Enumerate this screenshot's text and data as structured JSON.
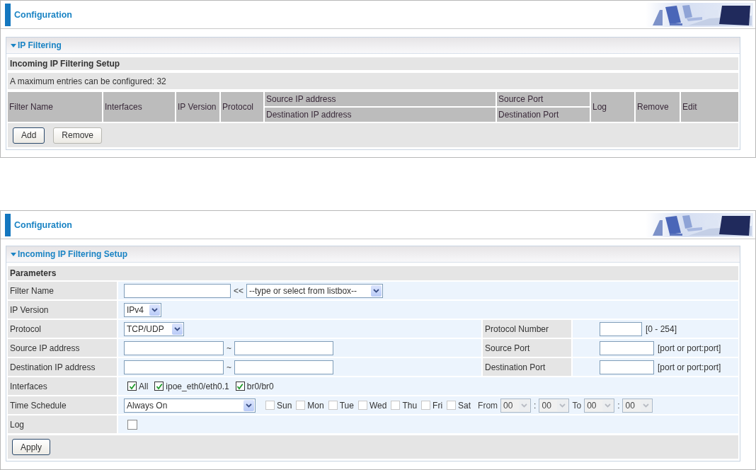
{
  "list_page": {
    "header": {
      "title": "Configuration"
    },
    "section": {
      "title": "IP Filtering",
      "expanded": true
    },
    "subtitle": "Incoming IP Filtering Setup",
    "note": "A maximum entries can be configured: 32",
    "table": {
      "columns": [
        {
          "label": "Filter Name"
        },
        {
          "label": "Interfaces"
        },
        {
          "label": "IP Version"
        },
        {
          "label": "Protocol"
        },
        {
          "top": "Source IP address",
          "bottom": "Destination IP address"
        },
        {
          "top": "Source Port",
          "bottom": "Destination Port"
        },
        {
          "label": "Log"
        },
        {
          "label": "Remove"
        },
        {
          "label": "Edit"
        }
      ]
    },
    "buttons": [
      {
        "label": "Add",
        "focused": true
      },
      {
        "label": "Remove",
        "focused": false
      }
    ]
  },
  "edit_page": {
    "header": {
      "title": "Configuration"
    },
    "section": {
      "title": "Incoming IP Filtering Setup",
      "expanded": true
    },
    "subtitle": "Parameters",
    "rows": [
      {
        "kind": "text_select",
        "label": "Filter Name",
        "separator": "<<",
        "select": "--type or select from listbox--"
      },
      {
        "kind": "select",
        "label": "IP Version",
        "select": "IPv4"
      },
      {
        "kind": "select",
        "label": "Protocol",
        "select": "TCP/UDP",
        "side": {
          "label": "Protocol Number",
          "hint": "[0 - 254]"
        }
      },
      {
        "kind": "range",
        "label": "Source IP address",
        "separator": "~",
        "side": {
          "label": "Source Port",
          "hint": "[port or port:port]"
        }
      },
      {
        "kind": "range",
        "label": "Destination IP address",
        "separator": "~",
        "side": {
          "label": "Destination Port",
          "hint": "[port or port:port]"
        }
      },
      {
        "kind": "checks",
        "label": "Interfaces",
        "options": [
          {
            "label": "All",
            "checked": true
          },
          {
            "label": "ipoe_eth0/eth0.1",
            "checked": true
          },
          {
            "label": "br0/br0",
            "checked": true
          }
        ]
      },
      {
        "kind": "schedule",
        "label": "Time Schedule",
        "select": "Always On",
        "days": [
          {
            "label": "Sun",
            "checked": false
          },
          {
            "label": "Mon",
            "checked": false
          },
          {
            "label": "Tue",
            "checked": false
          },
          {
            "label": "Wed",
            "checked": false
          },
          {
            "label": "Thu",
            "checked": false
          },
          {
            "label": "Fri",
            "checked": false
          },
          {
            "label": "Sat",
            "checked": false
          }
        ],
        "from_label": "From",
        "from": [
          "00",
          "00"
        ],
        "to_label": "To",
        "to": [
          "00",
          "00"
        ],
        "time_separator": ":",
        "time_disabled": true
      },
      {
        "kind": "checkbox",
        "label": "Log",
        "checked": false
      }
    ],
    "buttons": [
      {
        "label": "Apply",
        "focused": true
      }
    ]
  }
}
